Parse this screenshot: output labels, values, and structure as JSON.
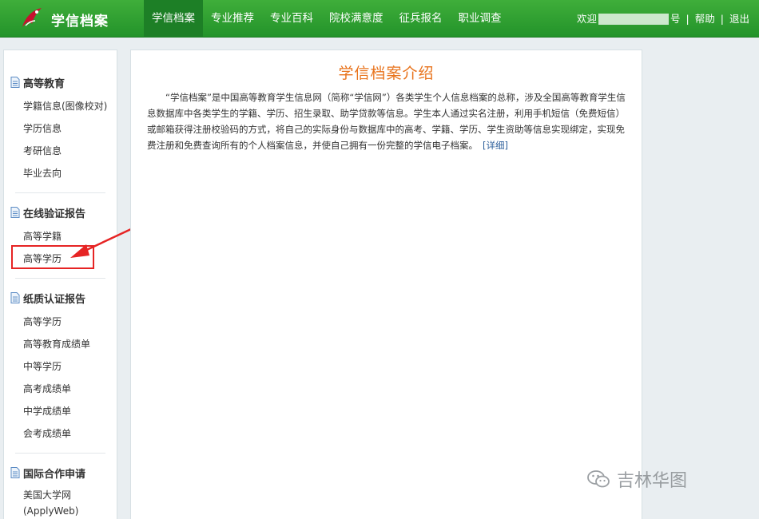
{
  "header": {
    "logo_text": "学信档案",
    "nav": [
      {
        "label": "学信档案",
        "active": true
      },
      {
        "label": "专业推荐",
        "active": false
      },
      {
        "label": "专业百科",
        "active": false
      },
      {
        "label": "院校满意度",
        "active": false
      },
      {
        "label": "征兵报名",
        "active": false
      },
      {
        "label": "职业调查",
        "active": false
      }
    ],
    "welcome": "欢迎",
    "account_suffix": "号",
    "divider": "|",
    "help": "帮助",
    "logout": "退出"
  },
  "sidebar": {
    "sections": [
      {
        "title": "高等教育",
        "items": [
          "学籍信息(图像校对)",
          "学历信息",
          "考研信息",
          "毕业去向"
        ]
      },
      {
        "title": "在线验证报告",
        "items": [
          "高等学籍",
          "高等学历"
        ]
      },
      {
        "title": "纸质认证报告",
        "items": [
          "高等学历",
          "高等教育成绩单",
          "中等学历",
          "高考成绩单",
          "中学成绩单",
          "会考成绩单"
        ]
      },
      {
        "title": "国际合作申请",
        "items": [
          "美国大学网(ApplyWeb)"
        ]
      }
    ]
  },
  "main": {
    "title": "学信档案介绍",
    "intro": "“学信档案”是中国高等教育学生信息网（简称“学信网”）各类学生个人信息档案的总称，涉及全国高等教育学生信息数据库中各类学生的学籍、学历、招生录取、助学贷款等信息。学生本人通过实名注册，利用手机短信（免费短信）或邮箱获得注册校验码的方式，将自己的实际身份与数据库中的高考、学籍、学历、学生资助等信息实现绑定，实现免费注册和免费查询所有的个人档案信息，并使自己拥有一份完整的学信电子档案。",
    "more": "[详细]"
  },
  "watermark": {
    "text": "吉林华图"
  },
  "colors": {
    "header_green": "#2ea235",
    "active_tab": "#1d7f26",
    "title_orange": "#e8731c",
    "highlight_red": "#e62424",
    "link_blue": "#2c5e9a"
  }
}
